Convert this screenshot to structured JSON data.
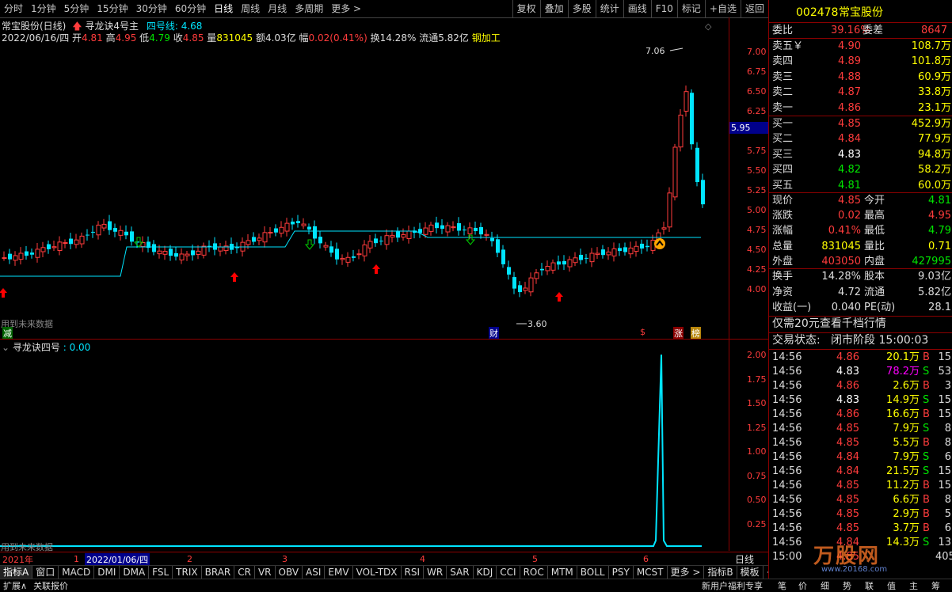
{
  "toolbar": {
    "periods": [
      "分时",
      "1分钟",
      "5分钟",
      "15分钟",
      "30分钟",
      "60分钟",
      "日线",
      "周线",
      "月线",
      "多周期",
      "更多 >"
    ],
    "active": "日线",
    "tools": [
      "复权",
      "叠加",
      "多股",
      "统计",
      "画线",
      "F10",
      "标记",
      "+自选",
      "返回"
    ]
  },
  "chart_header": {
    "title": "常宝股份(日线)",
    "indicator": "寻龙诀4号主",
    "line_label": "四号线: 4.68",
    "date": "2022/06/16/四",
    "open_label": "开",
    "open": "4.81",
    "high_label": "高",
    "high": "4.95",
    "low_label": "低",
    "low": "4.79",
    "close_label": "收",
    "close": "4.85",
    "vol_label": "量",
    "vol": "831045",
    "amt_label": "额",
    "amt": "4.03亿",
    "chg_label": "幅",
    "chg": "0.02(0.41%)",
    "turn_label": "换",
    "turn": "14.28%",
    "float_label": "流通",
    "float": "5.82亿",
    "sector": "钢加工"
  },
  "chart_annotations": {
    "max_label": "7.06",
    "min_label": "3.60",
    "price_tag": "5.95",
    "future_note": "用到未来数据",
    "badge_jian": "减",
    "badge_cai": "财",
    "badge_s": "$",
    "badge_zhang": "涨",
    "badge_bang": "榜"
  },
  "price_axis": [
    "7.00",
    "6.75",
    "6.50",
    "6.25",
    "6.00",
    "5.75",
    "5.50",
    "5.25",
    "5.00",
    "4.75",
    "4.50",
    "4.25",
    "4.00"
  ],
  "indicator_panel": {
    "title": "寻龙诀四号",
    "value": ": 0.00",
    "axis": [
      "2.00",
      "1.75",
      "1.50",
      "1.25",
      "1.00",
      "0.75",
      "0.50",
      "0.25"
    ],
    "future_note": "用到未来数据"
  },
  "dates": {
    "year": "2021年",
    "m1": "1",
    "cursor": "2022/01/06/四",
    "m2": "2",
    "m3": "3",
    "m4": "4",
    "m5": "5",
    "m6": "6",
    "period": "日线"
  },
  "tabs": [
    "指标A",
    "窗口",
    "MACD",
    "DMI",
    "DMA",
    "FSL",
    "TRIX",
    "BRAR",
    "CR",
    "VR",
    "OBV",
    "ASI",
    "EMV",
    "VOL-TDX",
    "RSI",
    "WR",
    "SAR",
    "KDJ",
    "CCI",
    "ROC",
    "MTM",
    "BOLL",
    "PSY",
    "MCST",
    "更多 >",
    "指标B",
    "模板",
    "+",
    "-"
  ],
  "bottom": {
    "left1": "扩展∧",
    "left2": "关联报价",
    "right": "新用户福利专享",
    "r2": "笔",
    "r3": "价",
    "r4": "细",
    "r5": "势",
    "r6": "联",
    "r7": "值",
    "r8": "主",
    "r9": "筹"
  },
  "quote": {
    "code": "002478",
    "name": "常宝股份",
    "weibi_label": "委比",
    "weibi": "39.16%",
    "weicha_label": "委差",
    "weicha": "8647",
    "asks": [
      {
        "label": "卖五￥",
        "price": "4.90",
        "vol": "108.7万"
      },
      {
        "label": "卖四",
        "price": "4.89",
        "vol": "101.8万"
      },
      {
        "label": "卖三",
        "price": "4.88",
        "vol": "60.9万"
      },
      {
        "label": "卖二",
        "price": "4.87",
        "vol": "33.8万"
      },
      {
        "label": "卖一",
        "price": "4.86",
        "vol": "23.1万"
      }
    ],
    "bids": [
      {
        "label": "买一",
        "price": "4.85",
        "vol": "452.9万"
      },
      {
        "label": "买二",
        "price": "4.84",
        "vol": "77.9万"
      },
      {
        "label": "买三",
        "price": "4.83",
        "vol": "94.8万"
      },
      {
        "label": "买四",
        "price": "4.82",
        "vol": "58.2万"
      },
      {
        "label": "买五",
        "price": "4.81",
        "vol": "60.0万"
      }
    ],
    "stats": [
      {
        "l1": "现价",
        "v1": "4.85",
        "l2": "今开",
        "v2": "4.81"
      },
      {
        "l1": "涨跌",
        "v1": "0.02",
        "l2": "最高",
        "v2": "4.95"
      },
      {
        "l1": "涨幅",
        "v1": "0.41%",
        "l2": "最低",
        "v2": "4.79"
      },
      {
        "l1": "总量",
        "v1": "831045",
        "l2": "量比",
        "v2": "0.71"
      },
      {
        "l1": "外盘",
        "v1": "403050",
        "l2": "内盘",
        "v2": "427995"
      }
    ],
    "stats2": [
      {
        "l1": "换手",
        "v1": "14.28%",
        "l2": "股本",
        "v2": "9.03亿"
      },
      {
        "l1": "净资",
        "v1": "4.72",
        "l2": "流通",
        "v2": "5.82亿"
      },
      {
        "l1": "收益(一)",
        "v1": "0.040",
        "l2": "PE(动)",
        "v2": "28.1"
      }
    ],
    "promo": "仅需20元查看千档行情",
    "status_label": "交易状态:",
    "status": "闭市阶段 15:00:03",
    "ticks": [
      {
        "t": "14:56",
        "p": "4.86",
        "v": "20.1万",
        "s": "B",
        "n": "15"
      },
      {
        "t": "14:56",
        "p": "4.83",
        "v": "78.2万",
        "s": "S",
        "n": "53"
      },
      {
        "t": "14:56",
        "p": "4.86",
        "v": "2.6万",
        "s": "B",
        "n": "3"
      },
      {
        "t": "14:56",
        "p": "4.83",
        "v": "14.9万",
        "s": "S",
        "n": "15"
      },
      {
        "t": "14:56",
        "p": "4.86",
        "v": "16.6万",
        "s": "B",
        "n": "15"
      },
      {
        "t": "14:56",
        "p": "4.85",
        "v": "7.9万",
        "s": "S",
        "n": "8"
      },
      {
        "t": "14:56",
        "p": "4.85",
        "v": "5.5万",
        "s": "B",
        "n": "8"
      },
      {
        "t": "14:56",
        "p": "4.84",
        "v": "7.9万",
        "s": "S",
        "n": "6"
      },
      {
        "t": "14:56",
        "p": "4.84",
        "v": "21.5万",
        "s": "S",
        "n": "15"
      },
      {
        "t": "14:56",
        "p": "4.85",
        "v": "11.2万",
        "s": "B",
        "n": "15"
      },
      {
        "t": "14:56",
        "p": "4.85",
        "v": "6.6万",
        "s": "B",
        "n": "8"
      },
      {
        "t": "14:56",
        "p": "4.85",
        "v": "2.9万",
        "s": "B",
        "n": "5"
      },
      {
        "t": "14:56",
        "p": "4.85",
        "v": "3.7万",
        "s": "B",
        "n": "6"
      },
      {
        "t": "14:56",
        "p": "4.84",
        "v": "14.3万",
        "s": "S",
        "n": "13"
      },
      {
        "t": "15:00",
        "p": "4.85",
        "v": "",
        "s": "",
        "n": "405"
      }
    ],
    "watermark": "万股网",
    "watermark_url": "www.20168.com"
  },
  "colors": {
    "up": "#ff3c3c",
    "down": "#00e5ff",
    "support": "#00e5ff",
    "label_red": "#ff3c3c",
    "grid_red": "#8b0000"
  }
}
